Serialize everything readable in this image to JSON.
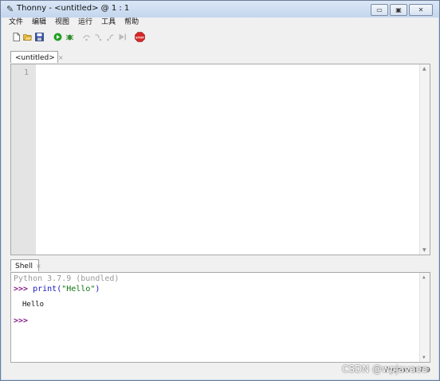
{
  "window": {
    "title": "Thonny  -  <untitled>  @  1 : 1",
    "controls": {
      "minimize": "▭",
      "maximize": "▣",
      "close": "✕"
    }
  },
  "menubar": [
    "文件",
    "编辑",
    "视图",
    "运行",
    "工具",
    "帮助"
  ],
  "toolbar": {
    "icons": [
      "new-file-icon",
      "open-folder-icon",
      "save-icon",
      "run-icon",
      "debug-icon",
      "step-over-icon",
      "step-into-icon",
      "step-out-icon",
      "resume-icon",
      "stop-icon"
    ],
    "stop_label": "STOP"
  },
  "editor": {
    "tab_label": "<untitled>",
    "tab_close": "×",
    "line_number": "1"
  },
  "shell": {
    "tab_label": "Shell",
    "tab_close": "×",
    "banner": "Python 3.7.9 (bundled)",
    "prompt": ">>> ",
    "command_fn": "print(",
    "command_str": "\"Hello\"",
    "command_end": ")",
    "output": "Hello",
    "prompt2": ">>>"
  },
  "statusbar": {
    "interpreter": "Python 3.7.9"
  },
  "watermark": "CSDN @wpjavaee",
  "colors": {
    "accent_run": "#22a022",
    "stop": "#d62828",
    "prompt": "#8b1d8b"
  }
}
